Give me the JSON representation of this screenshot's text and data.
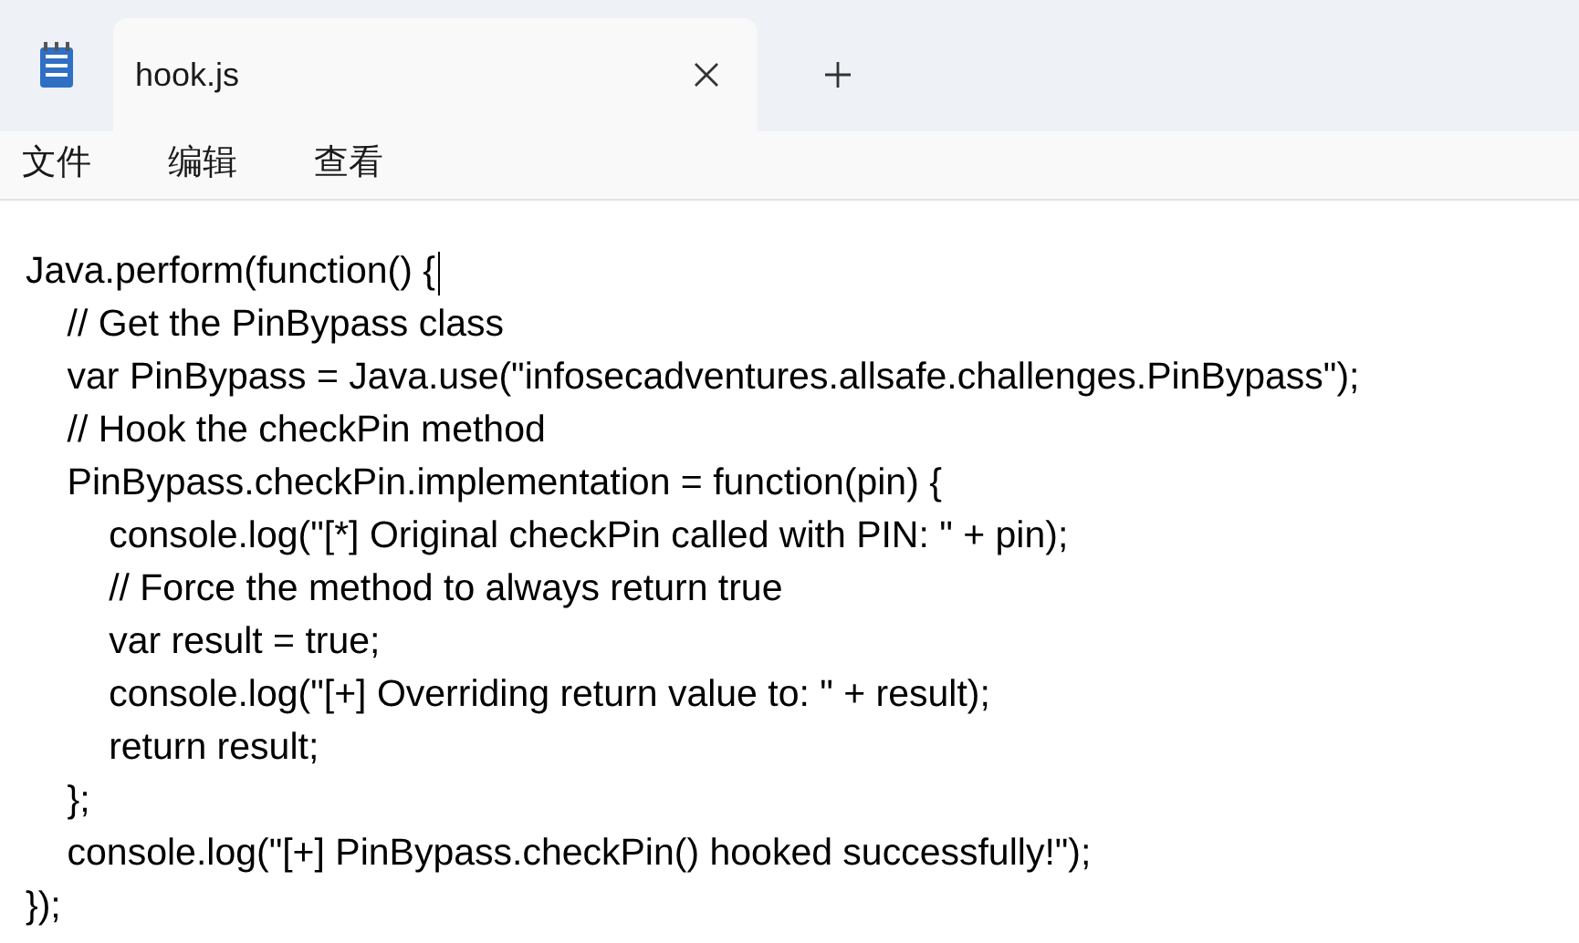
{
  "tabs": [
    {
      "title": "hook.js"
    }
  ],
  "menu": [
    "文件",
    "编辑",
    "查看"
  ],
  "editor": {
    "lines": [
      {
        "text": "Java.perform(function() {",
        "caret": true
      },
      {
        "text": "    // Get the PinBypass class",
        "caret": false
      },
      {
        "text": "    var PinBypass = Java.use(\"infosecadventures.allsafe.challenges.PinBypass\");",
        "caret": false
      },
      {
        "text": "    // Hook the checkPin method",
        "caret": false
      },
      {
        "text": "    PinBypass.checkPin.implementation = function(pin) {",
        "caret": false
      },
      {
        "text": "        console.log(\"[*] Original checkPin called with PIN: \" + pin);",
        "caret": false
      },
      {
        "text": "        // Force the method to always return true",
        "caret": false
      },
      {
        "text": "        var result = true;",
        "caret": false
      },
      {
        "text": "        console.log(\"[+] Overriding return value to: \" + result);",
        "caret": false
      },
      {
        "text": "        return result;",
        "caret": false
      },
      {
        "text": "    };",
        "caret": false
      },
      {
        "text": "    console.log(\"[+] PinBypass.checkPin() hooked successfully!\");",
        "caret": false
      },
      {
        "text": "});",
        "caret": false
      }
    ]
  }
}
